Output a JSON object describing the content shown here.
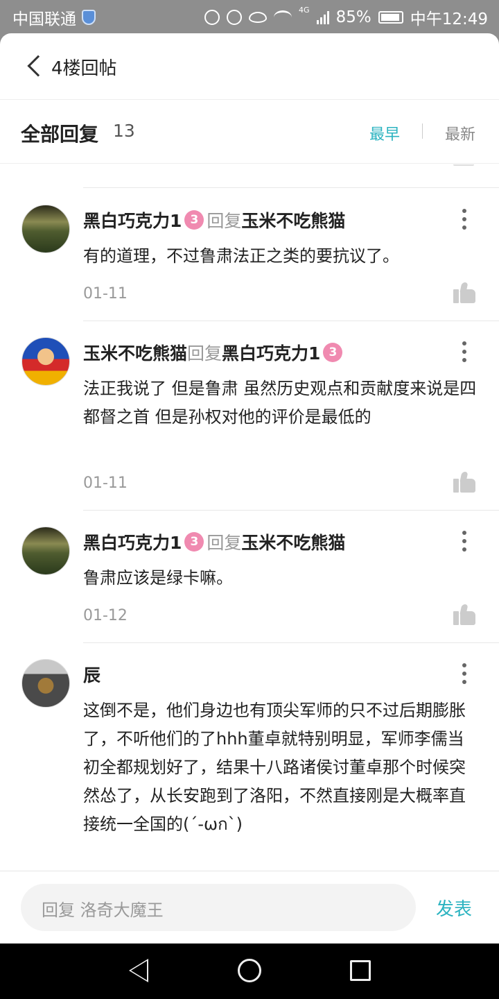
{
  "status_bar": {
    "carrier": "中国联通",
    "network": "4G",
    "battery": "85%",
    "time": "中午12:49"
  },
  "topbar": {
    "title": "4楼回帖"
  },
  "header": {
    "title": "全部回复",
    "count": "13",
    "sort_early": "最早",
    "sort_new": "最新"
  },
  "replies": [
    {
      "author": "黑白巧克力1",
      "badge": "3",
      "reply_word": "回复",
      "target": "玉米不吃熊猫",
      "text": "有的道理，不过鲁肃法正之类的要抗议了。",
      "date": "01-11"
    },
    {
      "author": "玉米不吃熊猫",
      "reply_word": "回复",
      "target": "黑白巧克力1",
      "badge": "3",
      "text": "法正我说了  但是鲁肃  虽然历史观点和贡献度来说是四都督之首  但是孙权对他的评价是最低的",
      "date": "01-11"
    },
    {
      "author": "黑白巧克力1",
      "badge": "3",
      "reply_word": "回复",
      "target": "玉米不吃熊猫",
      "text": "鲁肃应该是绿卡嘛。",
      "date": "01-12"
    },
    {
      "author": "辰",
      "text": "这倒不是，他们身边也有顶尖军师的只不过后期膨胀了，不听他们的了hhh董卓就特别明显，军师李儒当初全都规划好了，结果十八路诸侯讨董卓那个时候突然怂了，从长安跑到了洛阳，不然直接刚是大概率直接统一全国的(´-ωก`)"
    }
  ],
  "input": {
    "placeholder": "回复 洛奇大魔王",
    "send_label": "发表"
  }
}
